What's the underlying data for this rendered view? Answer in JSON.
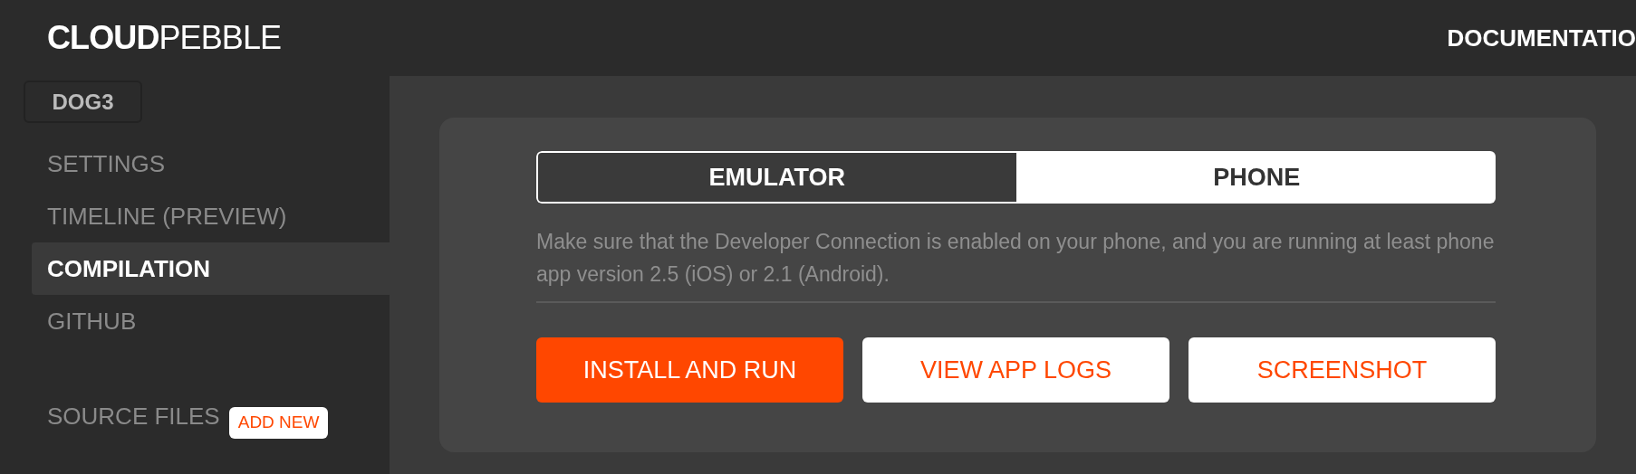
{
  "header": {
    "logo": "**CLOUD**PEBBLE",
    "nav": [
      "DOCUMENTATIO"
    ]
  },
  "sidebar": {
    "project": "DOG3",
    "items": [
      {
        "label": "SETTINGS",
        "selected": false
      },
      {
        "label": "TIMELINE (PREVIEW)",
        "selected": false
      },
      {
        "label": "COMPILATION",
        "selected": true
      },
      {
        "label": "GITHUB",
        "selected": false
      }
    ],
    "source_files": {
      "label": "SOURCE FILES",
      "action": "ADD NEW"
    }
  },
  "panel": {
    "targets": [
      {
        "label": "EMULATOR",
        "selected": true
      },
      {
        "label": "PHONE",
        "selected": false
      }
    ],
    "note": "Make sure that the Developer Connection is enabled on your phone, and you are running at least phone app version 2.5 (iOS) or 2.1 (Android).",
    "buttons": [
      {
        "label": "INSTALL AND RUN",
        "kind": "primary"
      },
      {
        "label": "VIEW APP LOGS",
        "kind": "secondary"
      },
      {
        "label": "SCREENSHOT",
        "kind": "secondary"
      }
    ]
  }
}
